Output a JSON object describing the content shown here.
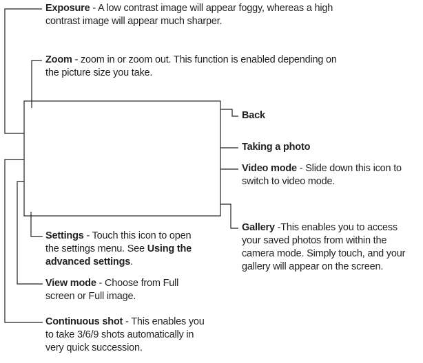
{
  "callouts": {
    "exposure": {
      "term": "Exposure",
      "desc_line1": " - A low contrast image will appear foggy, whereas a high",
      "desc_line2": "contrast image will appear much sharper."
    },
    "zoom": {
      "term": "Zoom",
      "desc_line1": " - zoom in or zoom out.  This function is enabled depending on",
      "desc_line2": "the picture size you take."
    },
    "back": {
      "term": "Back"
    },
    "taking_photo": {
      "term": "Taking a photo"
    },
    "video_mode": {
      "term": "Video mode",
      "desc_line1": " - Slide down this icon to",
      "desc_line2": "switch to video mode."
    },
    "gallery": {
      "term": "Gallery",
      "desc_line1": " -This enables you to access",
      "desc_line2": "your saved photos from within the",
      "desc_line3": "camera mode. Simply touch, and your",
      "desc_line4": "gallery will appear on the screen."
    },
    "settings": {
      "term": "Settings",
      "desc_line1": " - Touch this icon to open",
      "desc_line2a": "the settings menu. See ",
      "ref_line2": "Using the",
      "ref_line3": "advanced settings",
      "desc_line3_end": "."
    },
    "view_mode": {
      "term": "View mode",
      "desc_line1": " - Choose from Full",
      "desc_line2": "screen or Full image."
    },
    "continuous_shot": {
      "term": "Continuous shot",
      "desc_line1": " - This enables you",
      "desc_line2": "to take 3/6/9 shots automatically in",
      "desc_line3": "very quick succession."
    }
  }
}
